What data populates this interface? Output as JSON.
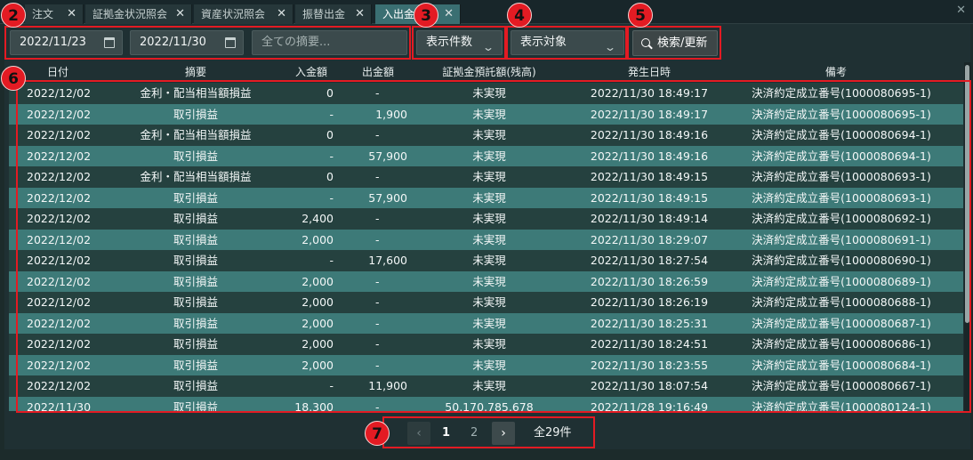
{
  "tabs": [
    {
      "label": "注文",
      "active": false
    },
    {
      "label": "証拠金状況照会",
      "active": false
    },
    {
      "label": "資産状況照会",
      "active": false
    },
    {
      "label": "振替出金",
      "active": false
    },
    {
      "label": "入出金",
      "active": true
    }
  ],
  "filters": {
    "date_from": "2022/11/23",
    "date_to": "2022/11/30",
    "summary_placeholder": "全ての摘要...",
    "count_select": "表示件数",
    "target_select": "表示対象",
    "search_label": "検索/更新"
  },
  "table": {
    "headers": [
      "日付",
      "摘要",
      "入金額",
      "出金額",
      "証拠金預託額(残高)",
      "発生日時",
      "備考"
    ],
    "rows": [
      [
        "2022/12/02",
        "金利・配当相当額損益",
        "0",
        "-",
        "未実現",
        "2022/11/30 18:49:17",
        "決済約定成立番号(1000080695-1)"
      ],
      [
        "2022/12/02",
        "取引損益",
        "-",
        "1,900",
        "未実現",
        "2022/11/30 18:49:17",
        "決済約定成立番号(1000080695-1)"
      ],
      [
        "2022/12/02",
        "金利・配当相当額損益",
        "0",
        "-",
        "未実現",
        "2022/11/30 18:49:16",
        "決済約定成立番号(1000080694-1)"
      ],
      [
        "2022/12/02",
        "取引損益",
        "-",
        "57,900",
        "未実現",
        "2022/11/30 18:49:16",
        "決済約定成立番号(1000080694-1)"
      ],
      [
        "2022/12/02",
        "金利・配当相当額損益",
        "0",
        "-",
        "未実現",
        "2022/11/30 18:49:15",
        "決済約定成立番号(1000080693-1)"
      ],
      [
        "2022/12/02",
        "取引損益",
        "-",
        "57,900",
        "未実現",
        "2022/11/30 18:49:15",
        "決済約定成立番号(1000080693-1)"
      ],
      [
        "2022/12/02",
        "取引損益",
        "2,400",
        "-",
        "未実現",
        "2022/11/30 18:49:14",
        "決済約定成立番号(1000080692-1)"
      ],
      [
        "2022/12/02",
        "取引損益",
        "2,000",
        "-",
        "未実現",
        "2022/11/30 18:29:07",
        "決済約定成立番号(1000080691-1)"
      ],
      [
        "2022/12/02",
        "取引損益",
        "-",
        "17,600",
        "未実現",
        "2022/11/30 18:27:54",
        "決済約定成立番号(1000080690-1)"
      ],
      [
        "2022/12/02",
        "取引損益",
        "2,000",
        "-",
        "未実現",
        "2022/11/30 18:26:59",
        "決済約定成立番号(1000080689-1)"
      ],
      [
        "2022/12/02",
        "取引損益",
        "2,000",
        "-",
        "未実現",
        "2022/11/30 18:26:19",
        "決済約定成立番号(1000080688-1)"
      ],
      [
        "2022/12/02",
        "取引損益",
        "2,000",
        "-",
        "未実現",
        "2022/11/30 18:25:31",
        "決済約定成立番号(1000080687-1)"
      ],
      [
        "2022/12/02",
        "取引損益",
        "2,000",
        "-",
        "未実現",
        "2022/11/30 18:24:51",
        "決済約定成立番号(1000080686-1)"
      ],
      [
        "2022/12/02",
        "取引損益",
        "2,000",
        "-",
        "未実現",
        "2022/11/30 18:23:55",
        "決済約定成立番号(1000080684-1)"
      ],
      [
        "2022/12/02",
        "取引損益",
        "-",
        "11,900",
        "未実現",
        "2022/11/30 18:07:54",
        "決済約定成立番号(1000080667-1)"
      ],
      [
        "2022/11/30",
        "取引損益",
        "18,300",
        "-",
        "50,170,785,678",
        "2022/11/28 19:16:49",
        "決済約定成立番号(1000080124-1)"
      ]
    ]
  },
  "pagination": {
    "prev": "‹",
    "next": "›",
    "pages": [
      "1",
      "2"
    ],
    "current": "1",
    "total": "全29件"
  },
  "annotations": [
    "2",
    "3",
    "4",
    "5",
    "6",
    "7"
  ],
  "colors": {
    "accent": "#e31b23",
    "row_even": "#3d7a78",
    "row_odd": "#25413f"
  }
}
